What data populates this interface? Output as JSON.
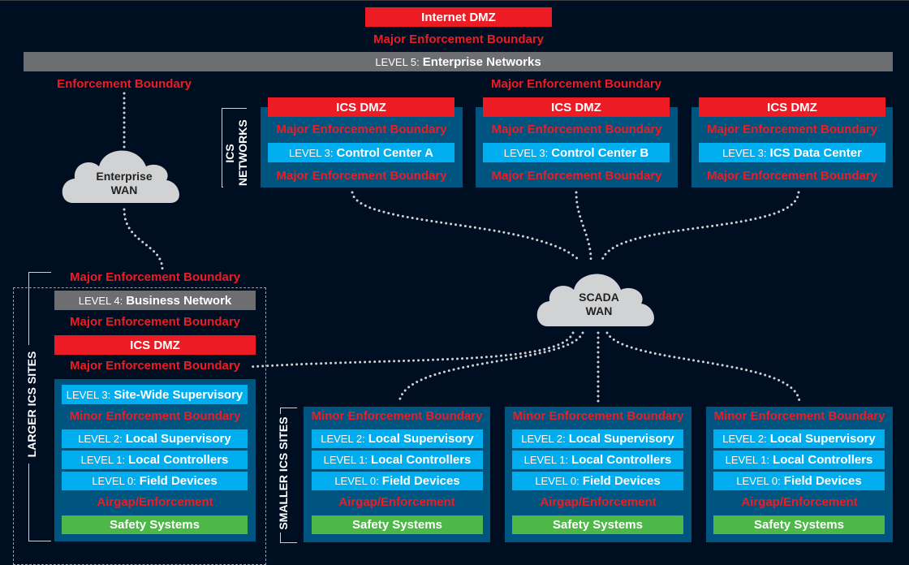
{
  "top": {
    "internet_dmz": "Internet DMZ",
    "major_boundary": "Major Enforcement Boundary",
    "level5": {
      "level": "LEVEL 5:",
      "name": "Enterprise Networks"
    }
  },
  "enterprise": {
    "boundary": "Enforcement Boundary",
    "cloud_line1": "Enterprise",
    "cloud_line2": "WAN"
  },
  "ics_networks": {
    "label_line1": "ICS",
    "label_line2": "NETWORKS",
    "top_boundary": "Major Enforcement Boundary",
    "centers": [
      {
        "dmz": "ICS DMZ",
        "boundary_top": "Major Enforcement Boundary",
        "level": "LEVEL 3:",
        "name": "Control Center A",
        "boundary_bottom": "Major Enforcement Boundary"
      },
      {
        "dmz": "ICS DMZ",
        "boundary_top": "Major Enforcement Boundary",
        "level": "LEVEL 3:",
        "name": "Control Center B",
        "boundary_bottom": "Major Enforcement Boundary"
      },
      {
        "dmz": "ICS DMZ",
        "boundary_top": "Major Enforcement Boundary",
        "level": "LEVEL 3:",
        "name": "ICS Data Center",
        "boundary_bottom": "Major Enforcement Boundary"
      }
    ]
  },
  "scada": {
    "cloud_line1": "SCADA",
    "cloud_line2": "WAN"
  },
  "larger_site": {
    "label": "LARGER ICS SITES",
    "boundary1": "Major Enforcement Boundary",
    "level4": {
      "level": "LEVEL 4:",
      "name": "Business Network"
    },
    "boundary2": "Major Enforcement Boundary",
    "dmz": "ICS DMZ",
    "boundary3": "Major Enforcement Boundary",
    "level3": {
      "level": "LEVEL 3:",
      "name": "Site-Wide Supervisory"
    },
    "minor_boundary": "Minor Enforcement Boundary",
    "level2": {
      "level": "LEVEL 2:",
      "name": "Local Supervisory"
    },
    "level1": {
      "level": "LEVEL 1:",
      "name": "Local Controllers"
    },
    "level0": {
      "level": "LEVEL 0:",
      "name": "Field Devices"
    },
    "airgap": "Airgap/Enforcement",
    "safety": "Safety Systems"
  },
  "smaller_sites": {
    "label": "SMALLER ICS SITES",
    "sites": [
      {
        "minor_boundary": "Minor Enforcement Boundary",
        "level2": {
          "level": "LEVEL 2:",
          "name": "Local Supervisory"
        },
        "level1": {
          "level": "LEVEL 1:",
          "name": "Local Controllers"
        },
        "level0": {
          "level": "LEVEL 0:",
          "name": "Field Devices"
        },
        "airgap": "Airgap/Enforcement",
        "safety": "Safety Systems"
      },
      {
        "minor_boundary": "Minor Enforcement Boundary",
        "level2": {
          "level": "LEVEL 2:",
          "name": "Local Supervisory"
        },
        "level1": {
          "level": "LEVEL 1:",
          "name": "Local Controllers"
        },
        "level0": {
          "level": "LEVEL 0:",
          "name": "Field Devices"
        },
        "airgap": "Airgap/Enforcement",
        "safety": "Safety Systems"
      },
      {
        "minor_boundary": "Minor Enforcement Boundary",
        "level2": {
          "level": "LEVEL 2:",
          "name": "Local Supervisory"
        },
        "level1": {
          "level": "LEVEL 1:",
          "name": "Local Controllers"
        },
        "level0": {
          "level": "LEVEL 0:",
          "name": "Field Devices"
        },
        "airgap": "Airgap/Enforcement",
        "safety": "Safety Systems"
      }
    ]
  },
  "colors": {
    "background": "#000e22",
    "dmz_red": "#ed1c24",
    "level_cyan": "#00aeef",
    "panel_blue": "#005580",
    "level_grey": "#6d6e71",
    "safety_green": "#4db848",
    "cloud_grey": "#d1d2d4"
  }
}
